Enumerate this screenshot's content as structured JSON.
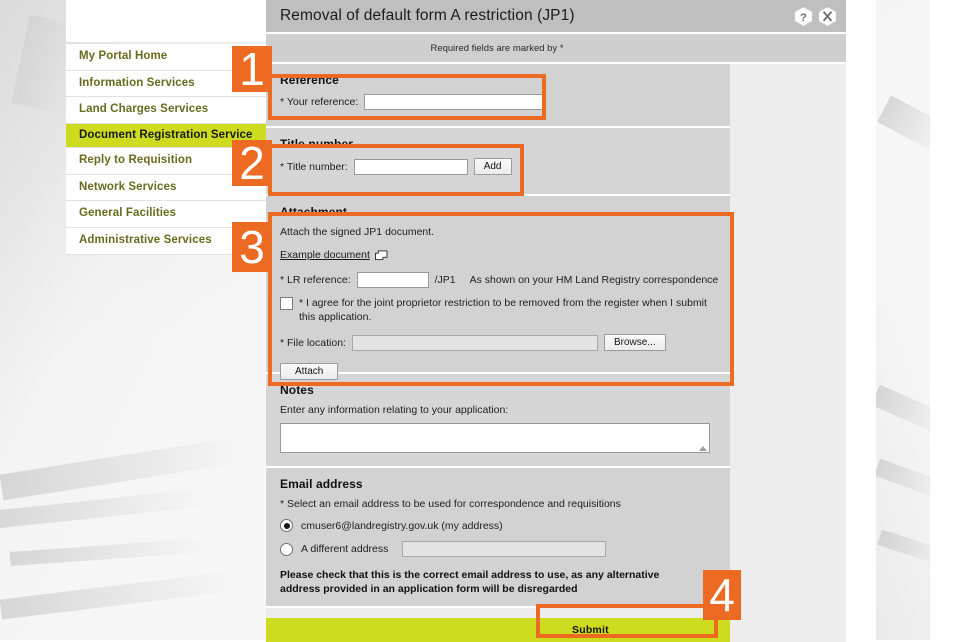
{
  "panel": {
    "title": "Removal of default form A restriction (JP1)",
    "required_note": "Required fields are marked by *",
    "help_icon": "help-hexagon-icon",
    "close_icon": "close-hexagon-icon"
  },
  "sidebar": {
    "items": [
      {
        "label": "My Portal Home",
        "active": false
      },
      {
        "label": "Information Services",
        "active": false
      },
      {
        "label": "Land Charges Services",
        "active": false
      },
      {
        "label": "Document Registration Service",
        "active": true
      },
      {
        "label": "Reply to Requisition",
        "active": false
      },
      {
        "label": "Network Services",
        "active": false
      },
      {
        "label": "General Facilities",
        "active": false
      },
      {
        "label": "Administrative Services",
        "active": false
      }
    ]
  },
  "reference": {
    "heading": "Reference",
    "label": "* Your reference:",
    "value": "",
    "placeholder": ""
  },
  "title_number": {
    "heading": "Title number",
    "label": "* Title number:",
    "value": "",
    "placeholder": "",
    "add_label": "Add"
  },
  "attachment": {
    "heading": "Attachment",
    "instruction": "Attach the signed JP1 document.",
    "example_link": "Example document",
    "example_link_icon": "open-in-new-window-icon",
    "lr_reference_label": "* LR reference:",
    "lr_reference_value": "",
    "lr_suffix": "/JP1",
    "lr_hint": "As shown on your HM Land Registry correspondence",
    "agree_checkbox_label": "* I agree for the joint proprietor restriction to be removed from the register when I submit this application.",
    "agree_checked": false,
    "file_location_label": "* File location:",
    "file_location_value": "",
    "browse_label": "Browse...",
    "attach_label": "Attach"
  },
  "notes": {
    "heading": "Notes",
    "instruction": "Enter any information relating to your application:",
    "value": "",
    "placeholder": ""
  },
  "email": {
    "heading": "Email address",
    "instruction": "* Select an email address to be used for correspondence and requisitions",
    "option_my_address": "cmuser6@landregistry.gov.uk (my address)",
    "option_my_address_selected": true,
    "option_different": "A different address",
    "option_different_selected": false,
    "different_value": "",
    "warning": "Please check that this is the correct email address to use, as any alternative address provided in an application form will be disregarded"
  },
  "submit": {
    "label": "Submit"
  },
  "annotations": {
    "steps": [
      "1",
      "2",
      "3",
      "4"
    ]
  },
  "colors": {
    "orange": "#ED6A23",
    "lime": "#CEDC20",
    "panel_title_gray": "#BFBFBF",
    "section_gray": "#D2D2D2",
    "body_gray": "#EDEDED"
  }
}
